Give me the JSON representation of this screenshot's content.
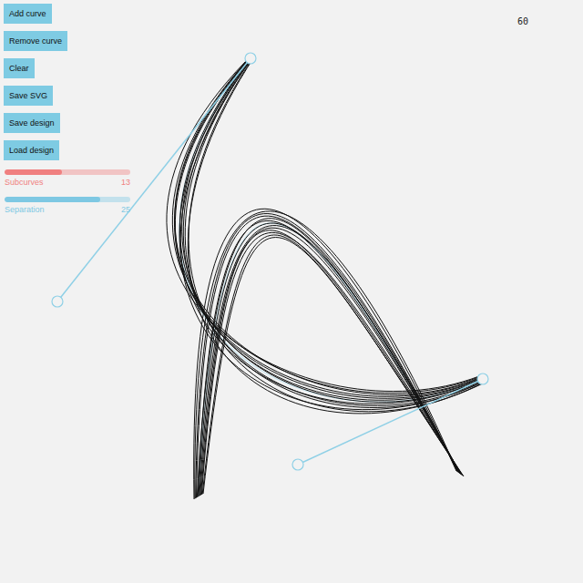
{
  "buttons": [
    {
      "label": "Add curve"
    },
    {
      "label": "Remove curve"
    },
    {
      "label": "Clear"
    },
    {
      "label": "Save SVG"
    },
    {
      "label": "Save design"
    },
    {
      "label": "Load design"
    }
  ],
  "sliders": [
    {
      "name": "Subcurves",
      "value": "13",
      "level": 0.46,
      "color": "#f08080"
    },
    {
      "name": "Separation",
      "value": "25",
      "level": 0.76,
      "color": "#7ec8e3"
    }
  ],
  "fps": "60",
  "curves": [
    {
      "points": [
        [
          275,
          64
        ],
        [
          63,
          331
        ],
        [
          327,
          510
        ],
        [
          530,
          416
        ]
      ],
      "selected": true
    },
    {
      "points": [
        [
          218,
          545
        ],
        [
          240,
          100
        ],
        [
          330,
          200
        ],
        [
          505,
          520
        ]
      ],
      "selected": false
    }
  ]
}
